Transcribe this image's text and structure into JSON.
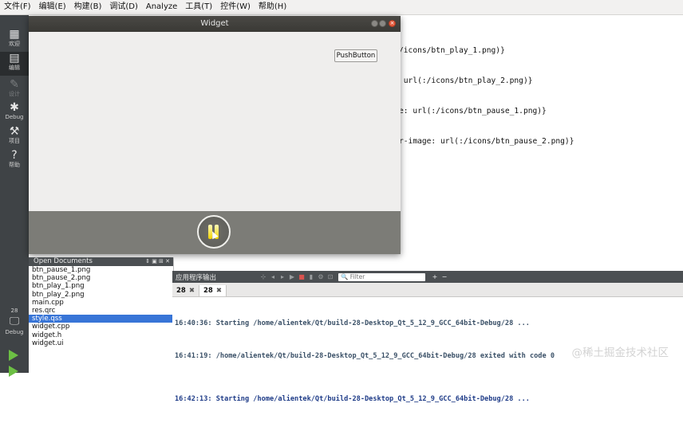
{
  "menubar": {
    "items": [
      "文件(F)",
      "编辑(E)",
      "构建(B)",
      "调试(D)",
      "Analyze",
      "工具(T)",
      "控件(W)",
      "帮助(H)"
    ]
  },
  "modebar": {
    "modes": [
      {
        "label": "欢迎",
        "icon": "grid-icon"
      },
      {
        "label": "编辑",
        "icon": "document-icon"
      },
      {
        "label": "设计",
        "icon": "pen-icon"
      },
      {
        "label": "Debug",
        "icon": "bug-icon"
      },
      {
        "label": "项目",
        "icon": "wrench-icon"
      },
      {
        "label": "帮助",
        "icon": "help-icon"
      }
    ],
    "kit_number": "28",
    "kit_label": "Debug"
  },
  "editor": {
    "lines": [
      "/icons/btn_play_1.png)}",
      " url(:/icons/btn_play_2.png)}",
      "e: url(:/icons/btn_pause_1.png)}",
      "r-image: url(:/icons/btn_pause_2.png)}"
    ]
  },
  "widget_window": {
    "title": "Widget",
    "push_button_label": "PushButton",
    "play_state": "paused"
  },
  "open_documents": {
    "title": "Open Documents",
    "files": [
      "btn_pause_1.png",
      "btn_pause_2.png",
      "btn_play_1.png",
      "btn_play_2.png",
      "main.cpp",
      "res.qrc",
      "style.qss",
      "widget.cpp",
      "widget.h",
      "widget.ui"
    ],
    "selected": "style.qss"
  },
  "output": {
    "title": "应用程序输出",
    "filter_placeholder": "Filter",
    "tabs": [
      "28",
      "28"
    ],
    "lines": [
      "16:40:36: Starting /home/alientek/Qt/build-28-Desktop_Qt_5_12_9_GCC_64bit-Debug/28 ...",
      "16:41:19: /home/alientek/Qt/build-28-Desktop_Qt_5_12_9_GCC_64bit-Debug/28 exited with code 0",
      "16:42:13: Starting /home/alientek/Qt/build-28-Desktop_Qt_5_12_9_GCC_64bit-Debug/28 ..."
    ]
  },
  "watermark": "@稀土掘金技术社区"
}
